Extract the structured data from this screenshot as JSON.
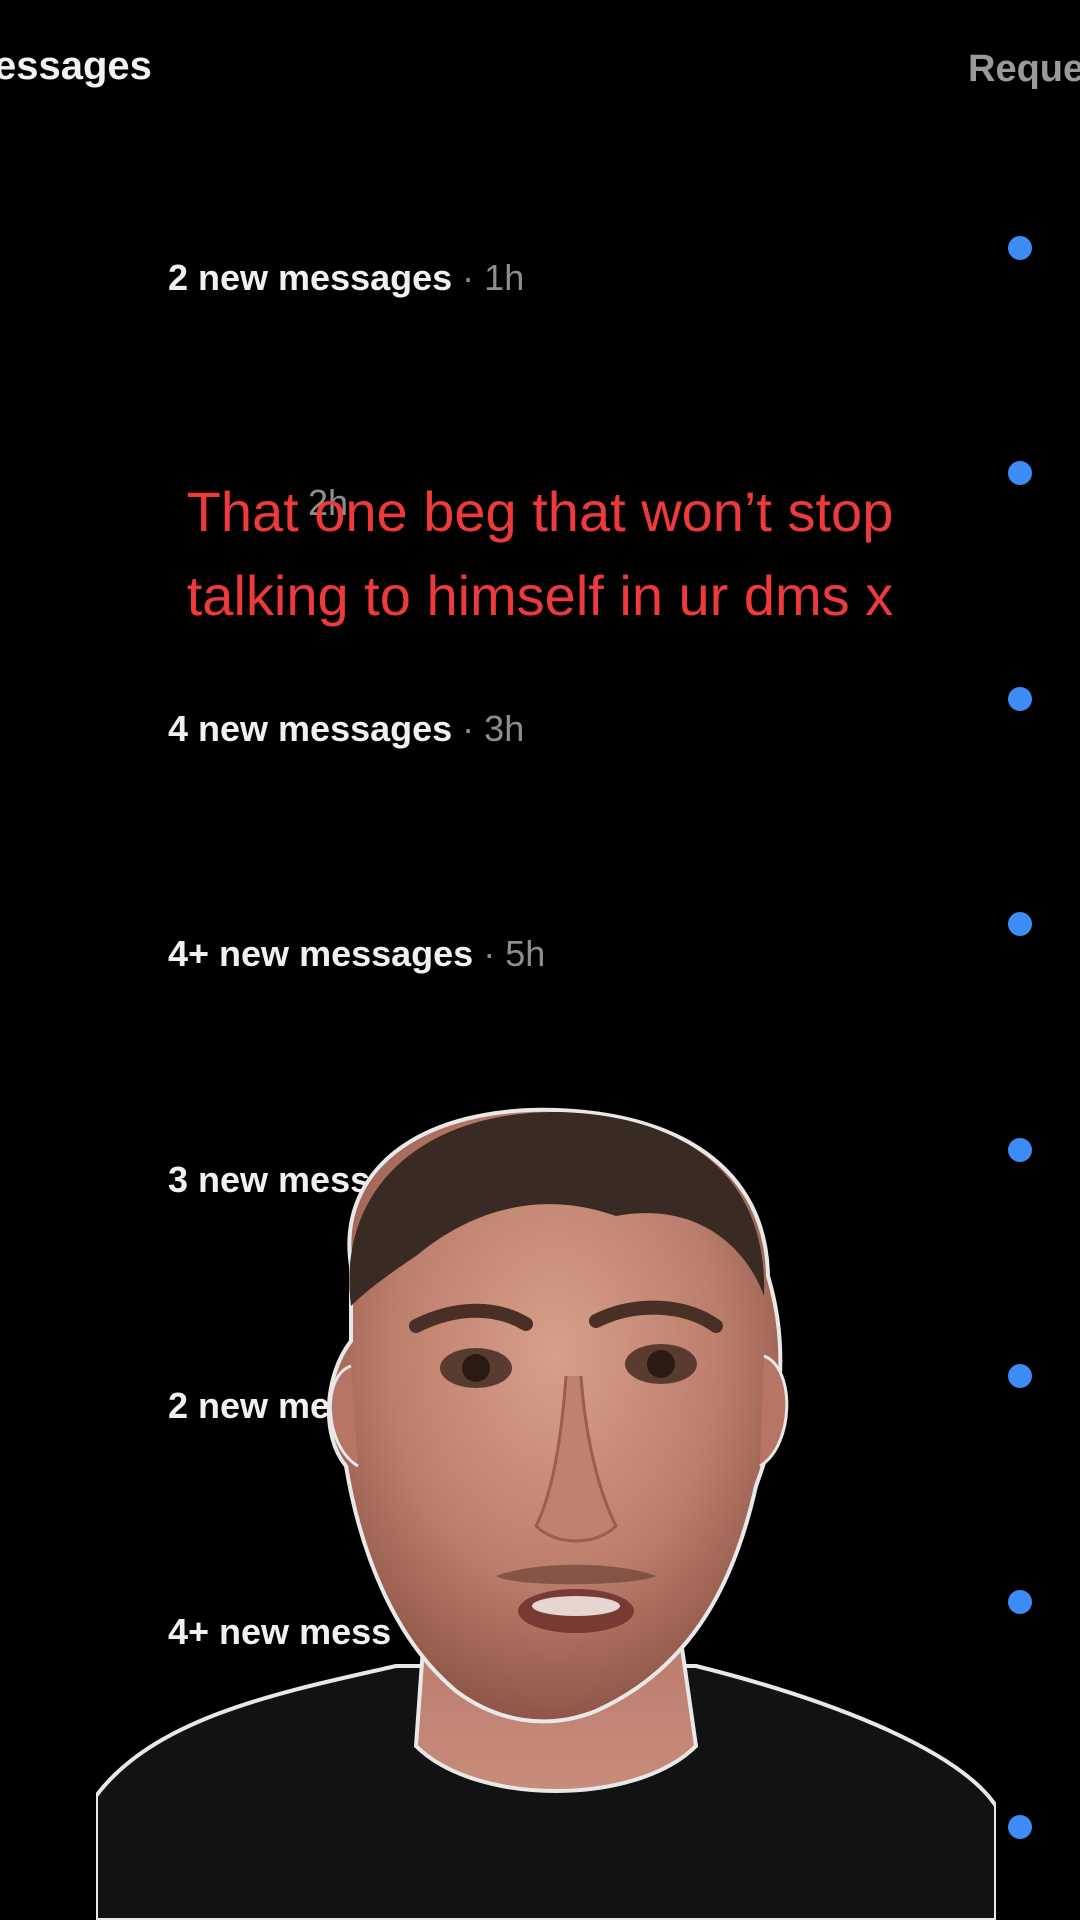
{
  "header": {
    "title": "essages",
    "requests": "Reque"
  },
  "threads": [
    {
      "count": "2 new messages",
      "separator": "·",
      "time": "1h"
    },
    {
      "count": "",
      "separator": "",
      "time": "2h"
    },
    {
      "count": "4 new messages",
      "separator": "·",
      "time": "3h"
    },
    {
      "count": "4+ new messages",
      "separator": "·",
      "time": "5h"
    },
    {
      "count": "3 new mess",
      "separator": "",
      "time": ""
    },
    {
      "count": "2 new me",
      "separator": "",
      "time": ""
    },
    {
      "count": "4+ new mess",
      "separator": "",
      "time": ""
    }
  ],
  "caption": {
    "line1": "That one beg that won’t stop",
    "line2": "talking to himself in ur dms x"
  },
  "colors": {
    "background": "#000000",
    "unread_dot": "#3d8bf5",
    "caption": "#ee3a3a"
  },
  "overlay": {
    "subject": "man-cutout-image"
  }
}
